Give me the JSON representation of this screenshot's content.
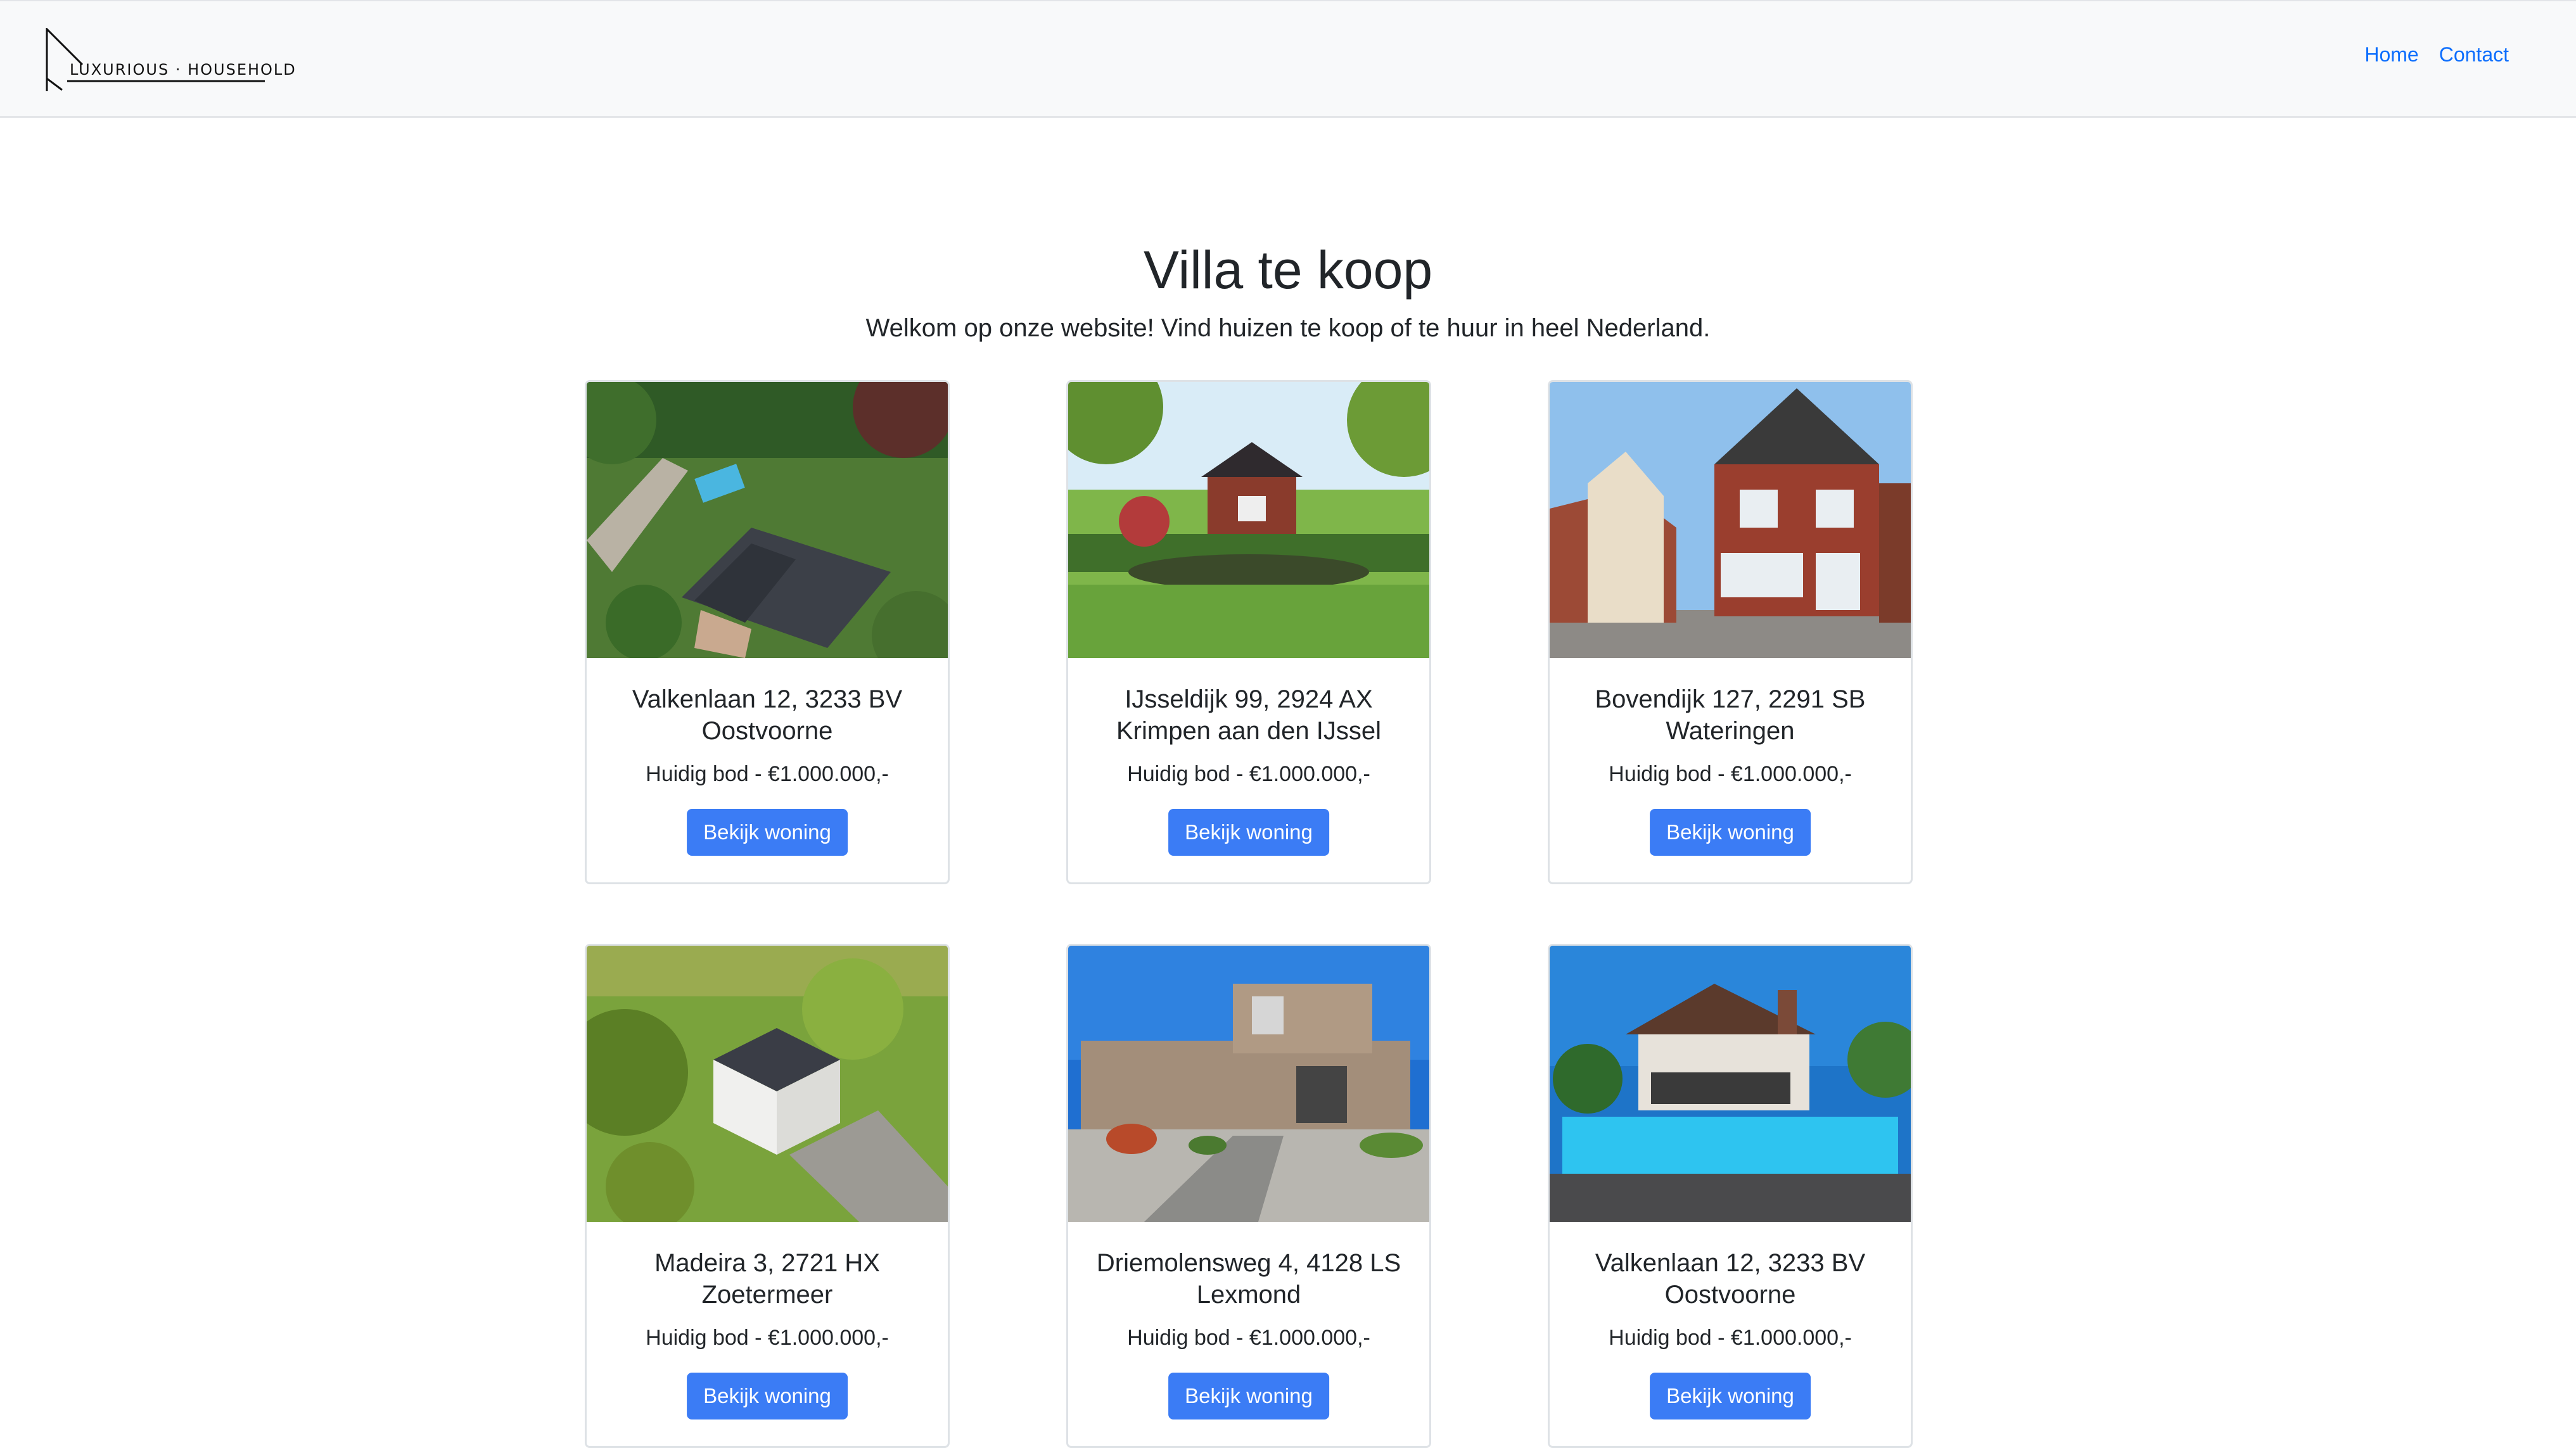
{
  "brand": {
    "logo_text": "LUXURIOUS · HOUSEHOLD"
  },
  "nav": {
    "items": [
      {
        "label": "Home"
      },
      {
        "label": "Contact"
      }
    ],
    "link_color": "#0d6efd"
  },
  "hero": {
    "title": "Villa te koop",
    "subtitle": "Welkom op onze website! Vind huizen te koop of te huur in heel Nederland."
  },
  "listings": [
    {
      "title": "Valkenlaan 12, 3233 BV Oostvoorne",
      "price": "Huidig bod - €1.000.000,-",
      "button": "Bekijk woning",
      "image": "aerial-villa-garden-pool-photo"
    },
    {
      "title": "IJsseldijk 99, 2924 AX Krimpen aan den IJssel",
      "price": "Huidig bod - €1.000.000,-",
      "button": "Bekijk woning",
      "image": "brick-bungalow-pond-garden-photo"
    },
    {
      "title": "Bovendijk 127, 2291 SB Wateringen",
      "price": "Huidig bod - €1.000.000,-",
      "button": "Bekijk woning",
      "image": "brick-townhouse-street-photo"
    },
    {
      "title": "Madeira 3, 2721 HX Zoetermeer",
      "price": "Huidig bod - €1.000.000,-",
      "button": "Bekijk woning",
      "image": "aerial-white-villa-trees-photo"
    },
    {
      "title": "Driemolensweg 4, 4128 LS Lexmond",
      "price": "Huidig bod - €1.000.000,-",
      "button": "Bekijk woning",
      "image": "modern-villa-paved-garden-photo"
    },
    {
      "title": "Valkenlaan 12, 3233 BV Oostvoorne",
      "price": "Huidig bod - €1.000.000,-",
      "button": "Bekijk woning",
      "image": "villa-swimming-pool-photo"
    }
  ],
  "colors": {
    "button": "#3b7cf5",
    "navbar_bg": "#f8f9fa"
  }
}
